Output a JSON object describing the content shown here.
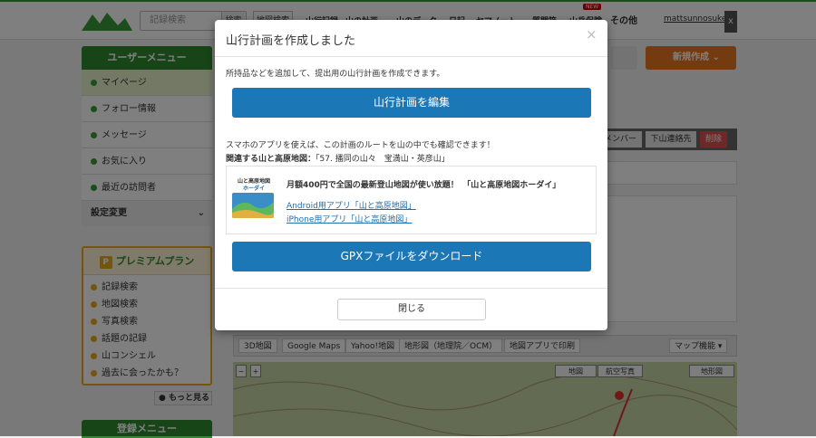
{
  "header": {
    "search_placeholder": "記録検索",
    "search_button": "検索",
    "map_search": "地図検索",
    "nav": [
      "山行記録",
      "山の計画",
      "山のデータ",
      "日記",
      "ヤマノート",
      "質問箱",
      "山岳保険"
    ],
    "new_badge": "NEW",
    "other": "その他",
    "user": "mattsunnosuke",
    "close": "x"
  },
  "sidebar": {
    "title": "ユーザーメニュー",
    "items": [
      "マイページ",
      "フォロー情報",
      "メッセージ",
      "お気に入り",
      "最近の訪問者"
    ],
    "settings": "設定変更",
    "premium_title": "プレミアムプラン",
    "premium_items": [
      "記録検索",
      "地図検索",
      "写真検索",
      "話題の記録",
      "山コンシェル",
      "過去に会ったかも？"
    ],
    "more": "もっと見る",
    "register_title": "登録メニュー"
  },
  "right": {
    "new_button": "新規作成",
    "tab_member": "メンバー",
    "tab_contact": "下山連絡先",
    "tab_delete": "削除"
  },
  "map_tabs": [
    "3D地図",
    "Google Maps",
    "Yahoo!地図",
    "地形図（地理院／OCM）",
    "地図アプリで印刷"
  ],
  "map_menu": "マップ機能",
  "map_types": [
    "地図",
    "航空写真",
    "地形図"
  ],
  "modal": {
    "title": "山行計画を作成しました",
    "close_x": "×",
    "description": "所持品などを追加して、提出用の山行計画を作成できます。",
    "edit_button": "山行計画を編集",
    "app_note": "スマホのアプリを使えば、この計画のルートを山の中でも確認できます！",
    "related_label": "関連する山と高原地図：",
    "related_value": "「57. 播同の山々　宝満山・英彦山」",
    "ad_logo_text": "山と高原地図",
    "ad_logo_sub": "ホーダイ",
    "ad_title": "月額400円で全国の最新登山地図が使い放題！　「山と高原地図ホーダイ」",
    "android_link": "Android用アプリ「山と高原地図」",
    "iphone_link": "iPhone用アプリ「山と高原地図」",
    "gpx_button": "GPXファイルをダウンロード",
    "close_button": "閉じる"
  }
}
